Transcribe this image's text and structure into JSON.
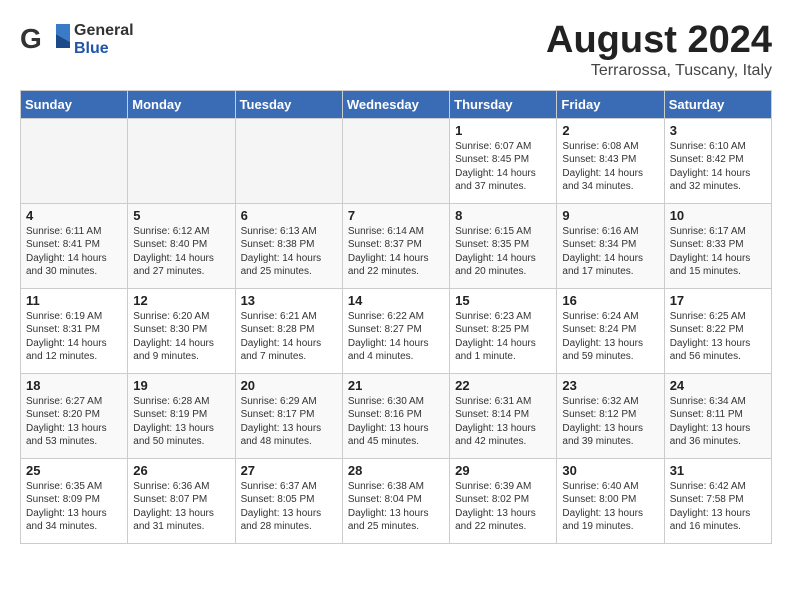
{
  "header": {
    "logo_general": "General",
    "logo_blue": "Blue",
    "month_title": "August 2024",
    "subtitle": "Terrarossa, Tuscany, Italy"
  },
  "weekdays": [
    "Sunday",
    "Monday",
    "Tuesday",
    "Wednesday",
    "Thursday",
    "Friday",
    "Saturday"
  ],
  "weeks": [
    [
      {
        "day": "",
        "empty": true
      },
      {
        "day": "",
        "empty": true
      },
      {
        "day": "",
        "empty": true
      },
      {
        "day": "",
        "empty": true
      },
      {
        "day": "1",
        "sunrise": "6:07 AM",
        "sunset": "8:45 PM",
        "daylight": "14 hours and 37 minutes."
      },
      {
        "day": "2",
        "sunrise": "6:08 AM",
        "sunset": "8:43 PM",
        "daylight": "14 hours and 34 minutes."
      },
      {
        "day": "3",
        "sunrise": "6:10 AM",
        "sunset": "8:42 PM",
        "daylight": "14 hours and 32 minutes."
      }
    ],
    [
      {
        "day": "4",
        "sunrise": "6:11 AM",
        "sunset": "8:41 PM",
        "daylight": "14 hours and 30 minutes."
      },
      {
        "day": "5",
        "sunrise": "6:12 AM",
        "sunset": "8:40 PM",
        "daylight": "14 hours and 27 minutes."
      },
      {
        "day": "6",
        "sunrise": "6:13 AM",
        "sunset": "8:38 PM",
        "daylight": "14 hours and 25 minutes."
      },
      {
        "day": "7",
        "sunrise": "6:14 AM",
        "sunset": "8:37 PM",
        "daylight": "14 hours and 22 minutes."
      },
      {
        "day": "8",
        "sunrise": "6:15 AM",
        "sunset": "8:35 PM",
        "daylight": "14 hours and 20 minutes."
      },
      {
        "day": "9",
        "sunrise": "6:16 AM",
        "sunset": "8:34 PM",
        "daylight": "14 hours and 17 minutes."
      },
      {
        "day": "10",
        "sunrise": "6:17 AM",
        "sunset": "8:33 PM",
        "daylight": "14 hours and 15 minutes."
      }
    ],
    [
      {
        "day": "11",
        "sunrise": "6:19 AM",
        "sunset": "8:31 PM",
        "daylight": "14 hours and 12 minutes."
      },
      {
        "day": "12",
        "sunrise": "6:20 AM",
        "sunset": "8:30 PM",
        "daylight": "14 hours and 9 minutes."
      },
      {
        "day": "13",
        "sunrise": "6:21 AM",
        "sunset": "8:28 PM",
        "daylight": "14 hours and 7 minutes."
      },
      {
        "day": "14",
        "sunrise": "6:22 AM",
        "sunset": "8:27 PM",
        "daylight": "14 hours and 4 minutes."
      },
      {
        "day": "15",
        "sunrise": "6:23 AM",
        "sunset": "8:25 PM",
        "daylight": "14 hours and 1 minute."
      },
      {
        "day": "16",
        "sunrise": "6:24 AM",
        "sunset": "8:24 PM",
        "daylight": "13 hours and 59 minutes."
      },
      {
        "day": "17",
        "sunrise": "6:25 AM",
        "sunset": "8:22 PM",
        "daylight": "13 hours and 56 minutes."
      }
    ],
    [
      {
        "day": "18",
        "sunrise": "6:27 AM",
        "sunset": "8:20 PM",
        "daylight": "13 hours and 53 minutes."
      },
      {
        "day": "19",
        "sunrise": "6:28 AM",
        "sunset": "8:19 PM",
        "daylight": "13 hours and 50 minutes."
      },
      {
        "day": "20",
        "sunrise": "6:29 AM",
        "sunset": "8:17 PM",
        "daylight": "13 hours and 48 minutes."
      },
      {
        "day": "21",
        "sunrise": "6:30 AM",
        "sunset": "8:16 PM",
        "daylight": "13 hours and 45 minutes."
      },
      {
        "day": "22",
        "sunrise": "6:31 AM",
        "sunset": "8:14 PM",
        "daylight": "13 hours and 42 minutes."
      },
      {
        "day": "23",
        "sunrise": "6:32 AM",
        "sunset": "8:12 PM",
        "daylight": "13 hours and 39 minutes."
      },
      {
        "day": "24",
        "sunrise": "6:34 AM",
        "sunset": "8:11 PM",
        "daylight": "13 hours and 36 minutes."
      }
    ],
    [
      {
        "day": "25",
        "sunrise": "6:35 AM",
        "sunset": "8:09 PM",
        "daylight": "13 hours and 34 minutes."
      },
      {
        "day": "26",
        "sunrise": "6:36 AM",
        "sunset": "8:07 PM",
        "daylight": "13 hours and 31 minutes."
      },
      {
        "day": "27",
        "sunrise": "6:37 AM",
        "sunset": "8:05 PM",
        "daylight": "13 hours and 28 minutes."
      },
      {
        "day": "28",
        "sunrise": "6:38 AM",
        "sunset": "8:04 PM",
        "daylight": "13 hours and 25 minutes."
      },
      {
        "day": "29",
        "sunrise": "6:39 AM",
        "sunset": "8:02 PM",
        "daylight": "13 hours and 22 minutes."
      },
      {
        "day": "30",
        "sunrise": "6:40 AM",
        "sunset": "8:00 PM",
        "daylight": "13 hours and 19 minutes."
      },
      {
        "day": "31",
        "sunrise": "6:42 AM",
        "sunset": "7:58 PM",
        "daylight": "13 hours and 16 minutes."
      }
    ]
  ]
}
